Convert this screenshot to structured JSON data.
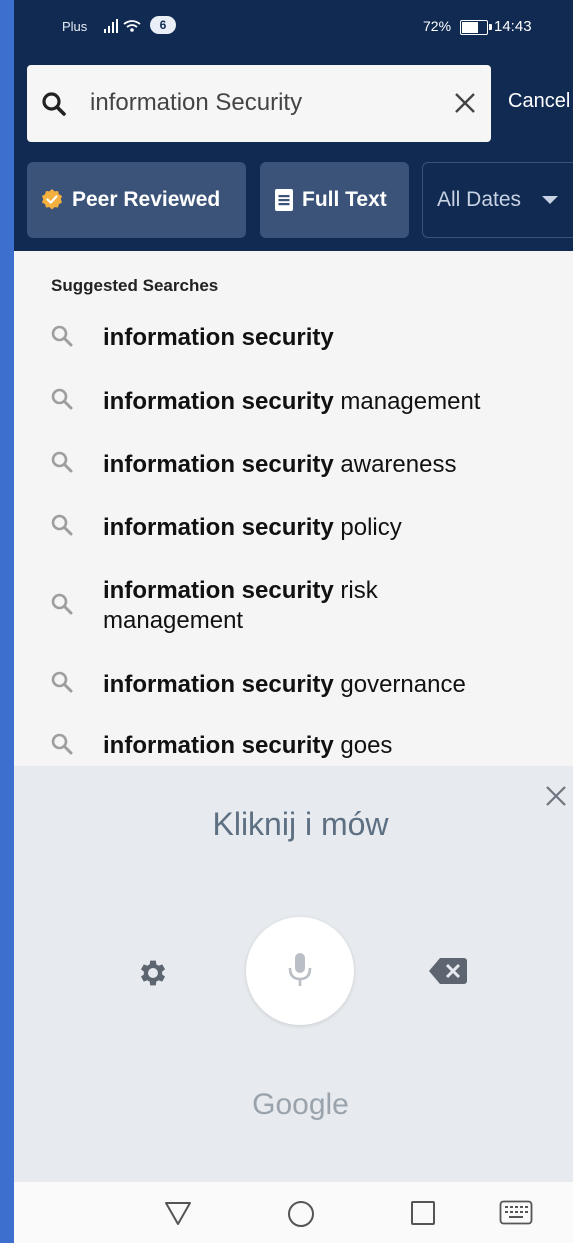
{
  "status_bar": {
    "carrier": "Plus",
    "notification_count": "6",
    "battery_percent": "72%",
    "battery_level": 0.72,
    "time": "14:43"
  },
  "search": {
    "value": "information Security",
    "cancel_label": "Cancel"
  },
  "filters": {
    "peer_reviewed": "Peer Reviewed",
    "full_text": "Full Text",
    "dates": "All Dates"
  },
  "suggestions": {
    "title": "Suggested Searches",
    "items": [
      {
        "bold": "information security",
        "rest": ""
      },
      {
        "bold": "information security",
        "rest": " management"
      },
      {
        "bold": "information security",
        "rest": " awareness"
      },
      {
        "bold": "information security",
        "rest": " policy"
      },
      {
        "bold": "information security",
        "rest": " risk management"
      },
      {
        "bold": "information security",
        "rest": " governance"
      },
      {
        "bold": "information security",
        "rest": " goes"
      }
    ]
  },
  "voice": {
    "prompt": "Kliknij i mów",
    "brand": "Google"
  },
  "colors": {
    "header": "#102a52",
    "chip": "#3b5378",
    "peer_badge": "#f3b03e",
    "page_edge": "#3d6fcf"
  }
}
